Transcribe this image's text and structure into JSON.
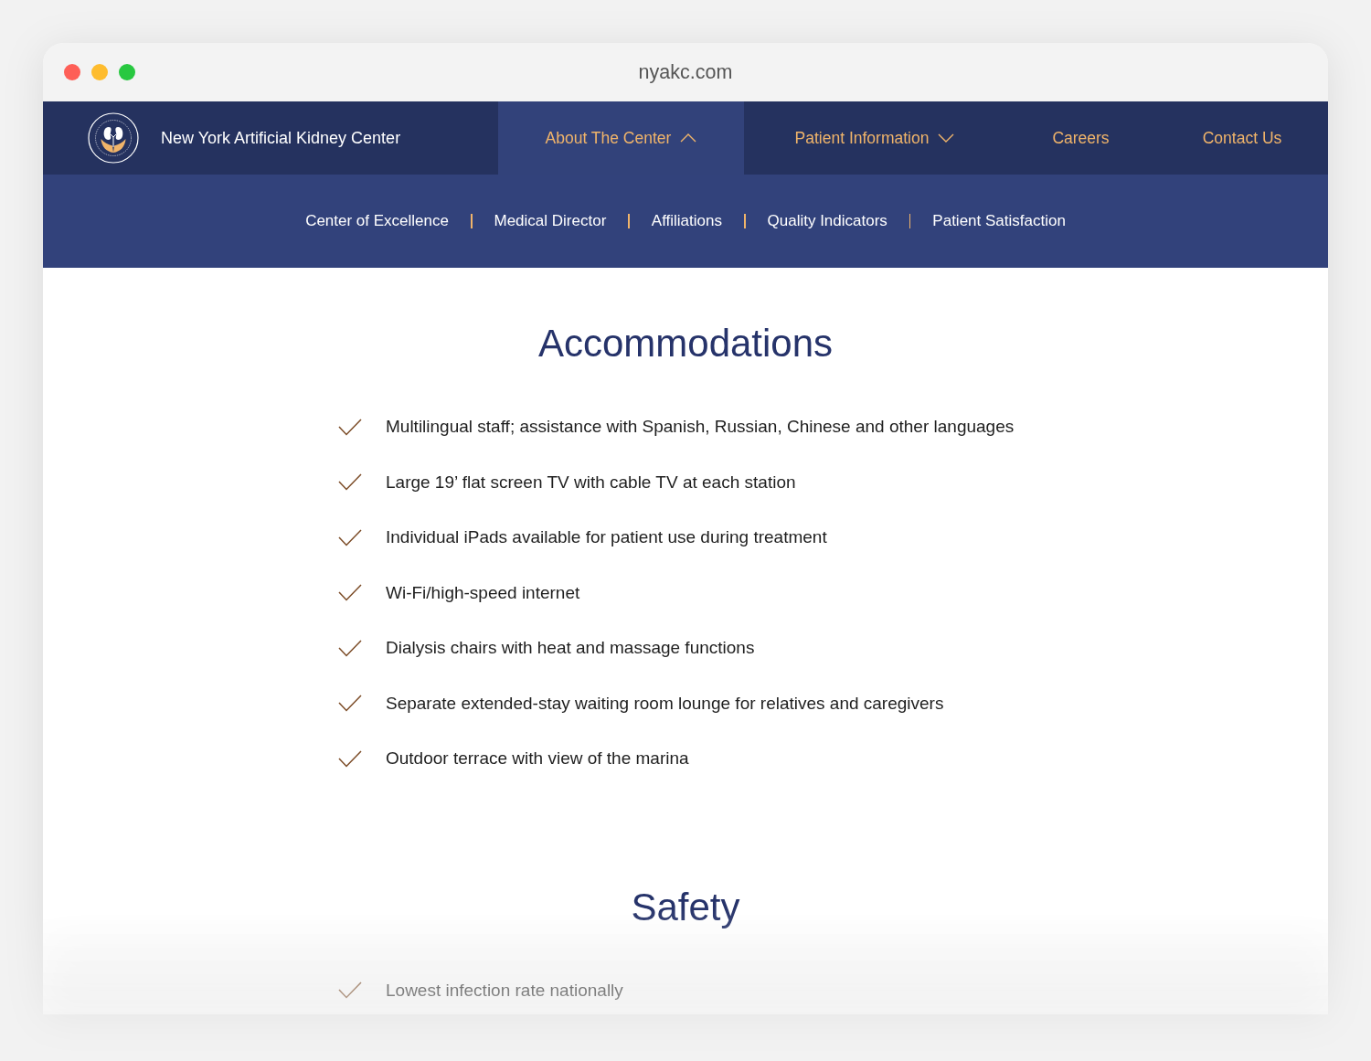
{
  "browser": {
    "url": "nyakc.com"
  },
  "site": {
    "name": "New York Artificial Kidney Center"
  },
  "nav": [
    {
      "label": "About The Center",
      "kind": "dropdown",
      "selected": true,
      "expanded": true
    },
    {
      "label": "Patient Information",
      "kind": "dropdown",
      "selected": false,
      "expanded": false
    },
    {
      "label": "Careers",
      "kind": "link",
      "selected": false
    },
    {
      "label": "Contact Us",
      "kind": "link",
      "selected": false
    }
  ],
  "subnav": [
    "Center of Excellence",
    "Medical Director",
    "Affiliations",
    "Quality Indicators",
    "Patient Satisfaction"
  ],
  "sections": [
    {
      "title": "Accommodations",
      "items": [
        "Multilingual staff; assistance with Spanish, Russian, Chinese and other languages",
        "Large 19’ flat screen TV with cable TV at each station",
        "Individual iPads available for patient use during treatment",
        "Wi-Fi/high-speed internet",
        "Dialysis chairs with heat and massage functions",
        "Separate extended-stay waiting room lounge for relatives and caregivers",
        "Outdoor terrace with view of the marina"
      ]
    },
    {
      "title": "Safety",
      "items": [
        "Lowest infection rate nationally"
      ]
    }
  ]
}
